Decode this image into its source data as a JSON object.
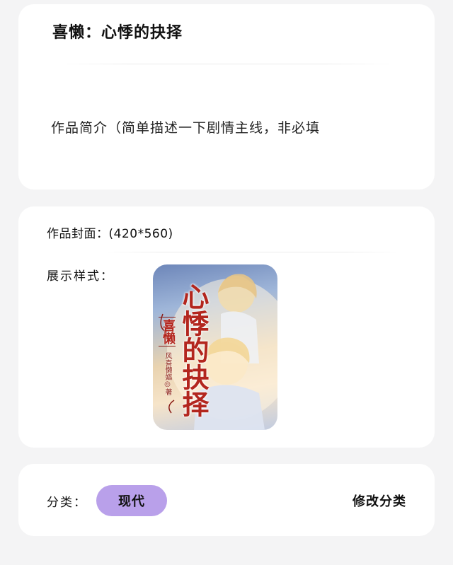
{
  "title_card": {
    "book_title": "喜懒：心悸的抉择",
    "synopsis_placeholder": "作品简介（简单描述一下剧情主线，非必填"
  },
  "cover_card": {
    "cover_label": "作品封面：(420*560)",
    "style_label": "展示样式：",
    "cover_text": {
      "main_title": "心悸的抉择",
      "sub_title": "喜懒",
      "author": "风喜懒嫗◎著"
    }
  },
  "category_card": {
    "category_label": "分类：",
    "category_value": "现代",
    "modify_label": "修改分类"
  },
  "colors": {
    "page_bg": "#f4f4f5",
    "card_bg": "#ffffff",
    "pill_bg": "#b9a0ea",
    "cover_title_red": "#b3261e"
  }
}
